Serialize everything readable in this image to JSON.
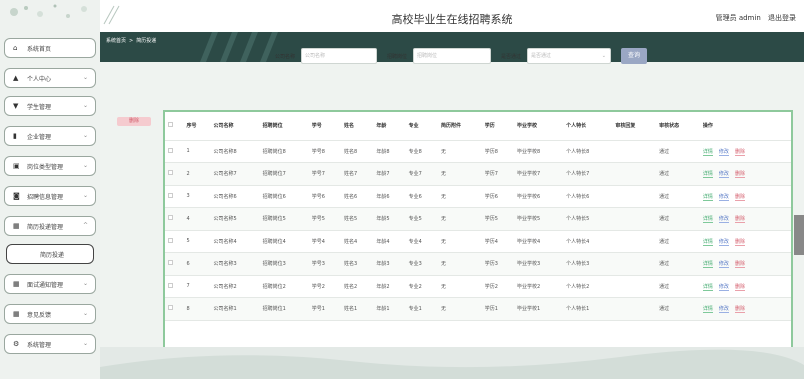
{
  "header": {
    "title": "高校毕业生在线招聘系统",
    "admin_label": "管理员 admin",
    "logout": "退出登录"
  },
  "sidebar": {
    "items": [
      {
        "label": "系统首页",
        "icon": "home-icon",
        "glyph": "⌂"
      },
      {
        "label": "个人中心",
        "icon": "user-icon",
        "glyph": "▲",
        "chevron": "⌄"
      },
      {
        "label": "学生管理",
        "icon": "filter-icon",
        "glyph": "▼",
        "chevron": "⌄"
      },
      {
        "label": "企业管理",
        "icon": "bar-chart-icon",
        "glyph": "▮",
        "chevron": "⌄"
      },
      {
        "label": "岗位类型管理",
        "icon": "book-icon",
        "glyph": "▣",
        "chevron": "⌄"
      },
      {
        "label": "招聘信息管理",
        "icon": "archive-icon",
        "glyph": "◙",
        "chevron": "⌄"
      },
      {
        "label": "简历投递管理",
        "icon": "grid-icon",
        "glyph": "▦",
        "chevron": "^"
      },
      {
        "label": "简历投递",
        "icon": "",
        "glyph": ""
      },
      {
        "label": "面试通知管理",
        "icon": "grid-icon",
        "glyph": "▦",
        "chevron": "⌄"
      },
      {
        "label": "意见反馈",
        "icon": "grid-icon",
        "glyph": "▦",
        "chevron": "⌄"
      },
      {
        "label": "系统管理",
        "icon": "settings-icon",
        "glyph": "⚙",
        "chevron": "⌄"
      }
    ]
  },
  "breadcrumb": {
    "home": "系统首页",
    "sep": ">",
    "current": "简历投递"
  },
  "search": {
    "company_label": "公司名称",
    "company_placeholder": "公司名称",
    "position_label": "招聘岗位",
    "position_placeholder": "招聘岗位",
    "approved_label": "是否通过",
    "approved_placeholder": "是否通过",
    "button": "查询"
  },
  "actions": {
    "delete": "删除"
  },
  "table": {
    "headers": [
      "",
      "序号",
      "公司名称",
      "招聘岗位",
      "学号",
      "姓名",
      "年龄",
      "专业",
      "简历附件",
      "学历",
      "毕业学校",
      "个人特长",
      "审核回复",
      "审核状态",
      "操作"
    ],
    "rows": [
      {
        "no": "1",
        "company": "公司名称8",
        "position": "招聘岗位8",
        "sid": "学号8",
        "name": "姓名8",
        "age": "年龄8",
        "major": "专业8",
        "attach": "无",
        "edu": "学历8",
        "school": "毕业学校8",
        "skill": "个人特长8",
        "reply": "",
        "status": "通过"
      },
      {
        "no": "2",
        "company": "公司名称7",
        "position": "招聘岗位7",
        "sid": "学号7",
        "name": "姓名7",
        "age": "年龄7",
        "major": "专业7",
        "attach": "无",
        "edu": "学历7",
        "school": "毕业学校7",
        "skill": "个人特长7",
        "reply": "",
        "status": "通过"
      },
      {
        "no": "3",
        "company": "公司名称6",
        "position": "招聘岗位6",
        "sid": "学号6",
        "name": "姓名6",
        "age": "年龄6",
        "major": "专业6",
        "attach": "无",
        "edu": "学历6",
        "school": "毕业学校6",
        "skill": "个人特长6",
        "reply": "",
        "status": "通过"
      },
      {
        "no": "4",
        "company": "公司名称5",
        "position": "招聘岗位5",
        "sid": "学号5",
        "name": "姓名5",
        "age": "年龄5",
        "major": "专业5",
        "attach": "无",
        "edu": "学历5",
        "school": "毕业学校5",
        "skill": "个人特长5",
        "reply": "",
        "status": "通过"
      },
      {
        "no": "5",
        "company": "公司名称4",
        "position": "招聘岗位4",
        "sid": "学号4",
        "name": "姓名4",
        "age": "年龄4",
        "major": "专业4",
        "attach": "无",
        "edu": "学历4",
        "school": "毕业学校4",
        "skill": "个人特长4",
        "reply": "",
        "status": "通过"
      },
      {
        "no": "6",
        "company": "公司名称3",
        "position": "招聘岗位3",
        "sid": "学号3",
        "name": "姓名3",
        "age": "年龄3",
        "major": "专业3",
        "attach": "无",
        "edu": "学历3",
        "school": "毕业学校3",
        "skill": "个人特长3",
        "reply": "",
        "status": "通过"
      },
      {
        "no": "7",
        "company": "公司名称2",
        "position": "招聘岗位2",
        "sid": "学号2",
        "name": "姓名2",
        "age": "年龄2",
        "major": "专业2",
        "attach": "无",
        "edu": "学历2",
        "school": "毕业学校2",
        "skill": "个人特长2",
        "reply": "",
        "status": "通过"
      },
      {
        "no": "8",
        "company": "公司名称1",
        "position": "招聘岗位1",
        "sid": "学号1",
        "name": "姓名1",
        "age": "年龄1",
        "major": "专业1",
        "attach": "无",
        "edu": "学历1",
        "school": "毕业学校1",
        "skill": "个人特长1",
        "reply": "",
        "status": "通过"
      }
    ],
    "row_actions": {
      "detail": "详情",
      "edit": "修改",
      "delete": "删除"
    }
  },
  "colors": {
    "banner": "#2c4a46",
    "accent_green": "#8ec99c",
    "search_button": "#9aa7c4",
    "danger": "#d45c6b"
  }
}
